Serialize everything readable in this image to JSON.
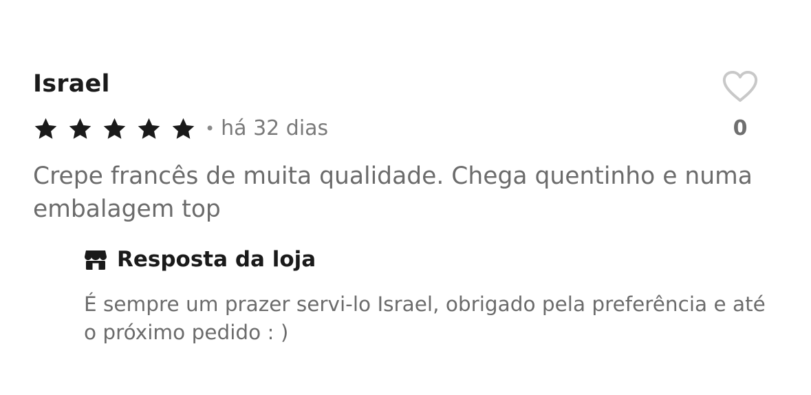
{
  "review": {
    "reviewer_name": "Israel",
    "rating": 5,
    "rating_max": 5,
    "separator": "•",
    "date": "há 32 dias",
    "text": "Crepe francês de muita qualidade. Chega quentinho e numa embalagem top",
    "likes": "0",
    "like_icon": "heart-outline-icon"
  },
  "store_reply": {
    "icon": "store-icon",
    "title": "Resposta da loja",
    "text": "É sempre um prazer servi-lo Israel, obrigado pela preferência e até o próximo pedido : )"
  },
  "colors": {
    "star": "#1a1a1a",
    "heart_outline": "#c8c8c8",
    "muted_text": "#6b6b6b",
    "title_text": "#1a1a1a"
  }
}
